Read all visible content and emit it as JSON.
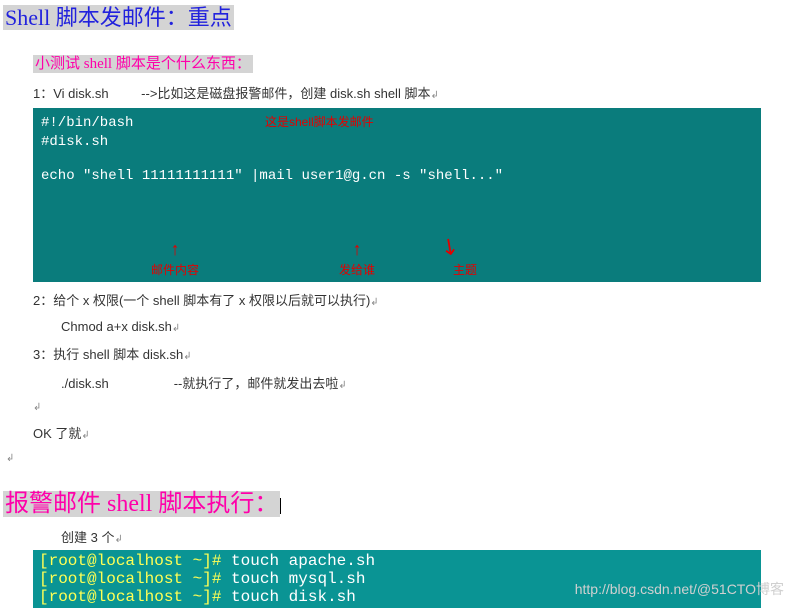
{
  "title1": "Shell 脚本发邮件：重点",
  "subtitle1": "小测试 shell 脚本是个什么东西：",
  "line1_prefix": "1：Vi disk.sh",
  "line1_suffix": "-->比如这是磁盘报警邮件，创建 disk.sh shell 脚本",
  "code1": {
    "l1": "#!/bin/bash",
    "l2": "#disk.sh",
    "l3": "echo \"shell 11111111111\" |mail user1@g.cn -s \"shell...\"",
    "anno_top": "这是shell脚本发邮件",
    "anno1": "邮件内容",
    "anno2": "发给谁",
    "anno3": "主题"
  },
  "line2": "2：给个 x 权限(一个  shell 脚本有了 x 权限以后就可以执行)",
  "line2b": "Chmod a+x disk.sh",
  "line3": "3：执行 shell 脚本  disk.sh",
  "line3b_prefix": "./disk.sh",
  "line3b_suffix": "--就执行了，邮件就发出去啦",
  "ok": "OK 了就",
  "title2": "报警邮件 shell 脚本执行：",
  "create": "创建 3 个",
  "term": {
    "prompt": "[root@localhost ~]#",
    "c1": "touch apache.sh",
    "c2": "touch mysql.sh",
    "c3": "touch disk.sh"
  },
  "ret": "↲",
  "watermark": "http://blog.csdn.net/@51CTO博客"
}
